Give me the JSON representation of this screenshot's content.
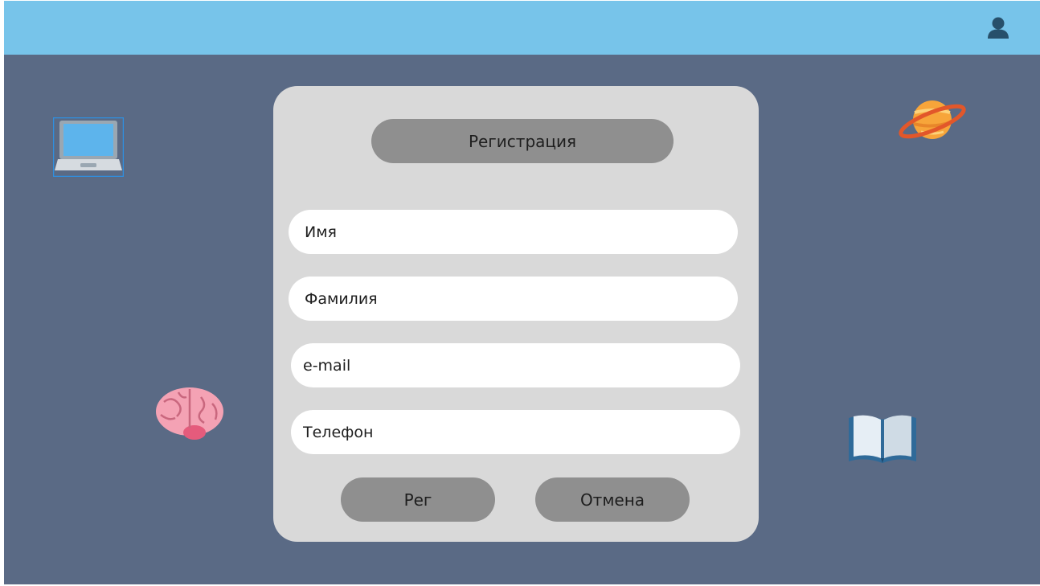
{
  "header": {
    "user_icon": "user-icon"
  },
  "decorations": {
    "laptop": "laptop-icon",
    "planet": "planet-icon",
    "brain": "brain-icon",
    "book": "book-icon"
  },
  "form": {
    "title": "Регистрация",
    "fields": {
      "first_name": {
        "value": "",
        "placeholder": "Имя"
      },
      "last_name": {
        "value": "",
        "placeholder": "Фамилия"
      },
      "email": {
        "value": "",
        "placeholder": "e-mail"
      },
      "phone": {
        "value": "",
        "placeholder": "Телефон"
      }
    },
    "submit_label": "Рег",
    "cancel_label": "Отмена"
  },
  "colors": {
    "header_bg": "#77c4ea",
    "page_bg": "#5a6a85",
    "panel_bg": "#d9d9d9",
    "pill_bg": "#8f8f8f",
    "field_bg": "#ffffff"
  }
}
